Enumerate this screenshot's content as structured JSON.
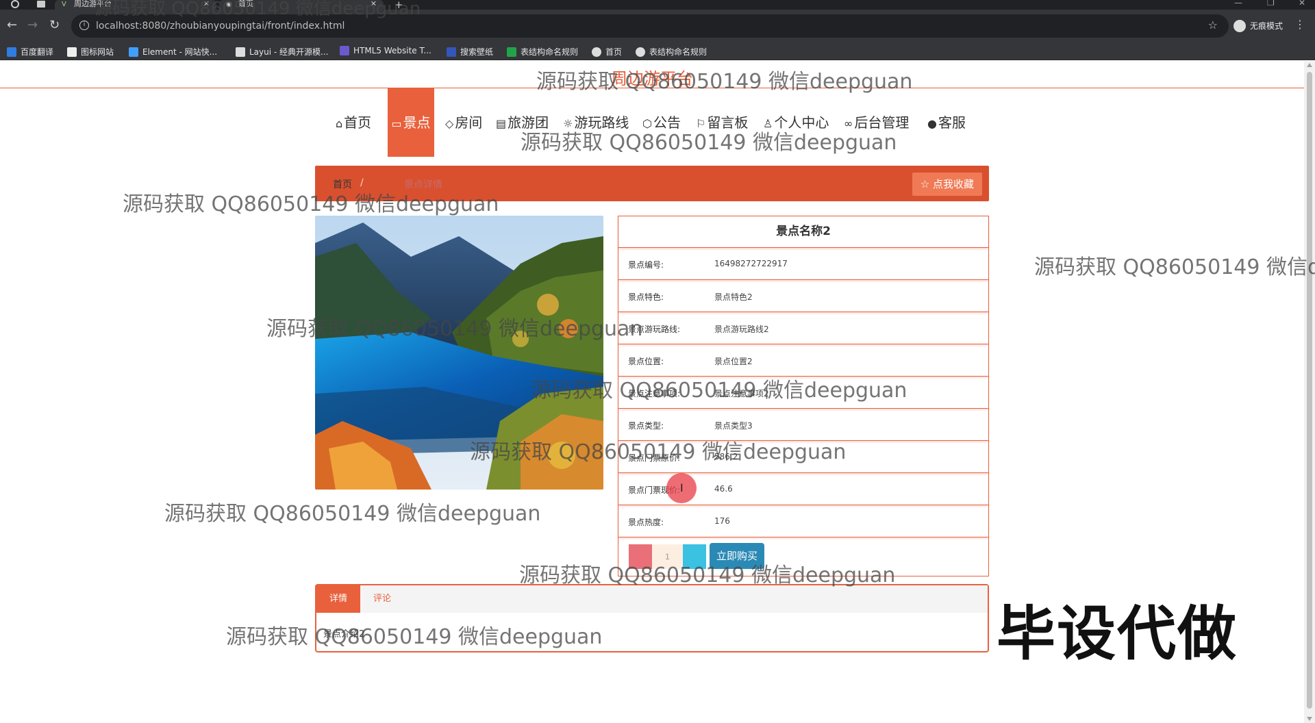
{
  "browser": {
    "tabs": [
      {
        "title": "周边游平台"
      },
      {
        "title": "首页"
      }
    ],
    "url": "localhost:8080/zhoubianyoupingtai/front/index.html",
    "profile_label": "无痕模式",
    "bookmarks": [
      "百度翻译",
      "图标网站",
      "Element - 网站快...",
      "Layui - 经典开源模...",
      "HTML5 Website T...",
      "搜索壁纸",
      "表结构命名规则",
      "首页",
      "表结构命名规则"
    ]
  },
  "site": {
    "title": "周边游平台"
  },
  "nav": [
    {
      "label": "首页",
      "icon": "home-icon"
    },
    {
      "label": "景点",
      "icon": "ticket-icon"
    },
    {
      "label": "房间",
      "icon": "tag-icon"
    },
    {
      "label": "旅游团",
      "icon": "calendar-icon"
    },
    {
      "label": "游玩路线",
      "icon": "sun-icon"
    },
    {
      "label": "公告",
      "icon": "cube-icon"
    },
    {
      "label": "留言板",
      "icon": "flag-icon"
    },
    {
      "label": "个人中心",
      "icon": "user-icon"
    },
    {
      "label": "后台管理",
      "icon": "link-icon"
    },
    {
      "label": "客服",
      "icon": "chat-icon"
    }
  ],
  "breadcrumb": {
    "home": "首页",
    "separator": "/",
    "current": "景点详情"
  },
  "favorite_label": "点我收藏",
  "detail": {
    "title": "景点名称2",
    "rows": [
      {
        "key": "景点编号:",
        "value": "16498272722917"
      },
      {
        "key": "景点特色:",
        "value": "景点特色2"
      },
      {
        "key": "景点游玩路线:",
        "value": "景点游玩路线2"
      },
      {
        "key": "景点位置:",
        "value": "景点位置2"
      },
      {
        "key": "景点注意事项:",
        "value": "景点注意事项2"
      },
      {
        "key": "景点类型:",
        "value": "景点类型3"
      },
      {
        "key": "景点门票原价:",
        "value": "586.2"
      },
      {
        "key": "景点门票现价:",
        "value": "46.6"
      },
      {
        "key": "景点热度:",
        "value": "176"
      }
    ],
    "quantity": "1",
    "buy_label": "立即购买"
  },
  "tabs": {
    "detail_label": "详情",
    "comment_label": "评论",
    "content": "景点介绍2"
  },
  "watermark_text": "源码获取 QQ86050149 微信deepguan",
  "stamp_text": "毕设代做",
  "colors": {
    "accent": "#e8613c",
    "crumb_bar": "#d9502f",
    "buy_button": "#2b8ab5"
  }
}
